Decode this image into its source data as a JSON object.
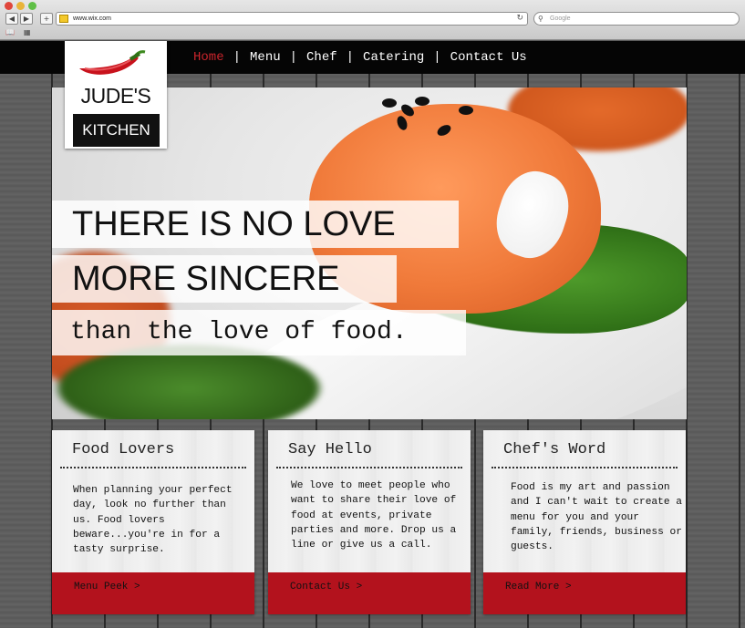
{
  "browser": {
    "url": "www.wix.com",
    "search_placeholder": "Google",
    "back_glyph": "◀",
    "forward_glyph": "▶",
    "add_glyph": "+",
    "reload_glyph": "↻",
    "search_glyph": "⚲",
    "bookmarks_glyph": "📖",
    "grid_glyph": "▦"
  },
  "nav": {
    "items": [
      "Home",
      "Menu",
      "Chef",
      "Catering",
      "Contact Us"
    ],
    "separator": "|",
    "active_index": 0,
    "active_color": "#c8242b"
  },
  "logo": {
    "title": "JUDE'S",
    "subtitle": "KITCHEN"
  },
  "hero": {
    "line1": "THERE IS NO LOVE",
    "line2": "MORE SINCERE",
    "line3": "than the love of food."
  },
  "cards": [
    {
      "title": "Food Lovers",
      "body": "When planning your perfect day, look no further than us. Food lovers beware...you're in for a tasty surprise.",
      "cta": "Menu Peek >"
    },
    {
      "title": "Say Hello",
      "body": "We love to meet people who want to share their love of food at events, private parties and more. Drop us a line or give us a call.",
      "cta": "Contact Us >"
    },
    {
      "title": "Chef's Word",
      "body": "Food is my art and passion and I can't wait to create a menu for you and your family, friends, business or guests.",
      "cta": "Read More >"
    }
  ],
  "colors": {
    "accent": "#b3121d",
    "nav_bg": "#050505"
  }
}
